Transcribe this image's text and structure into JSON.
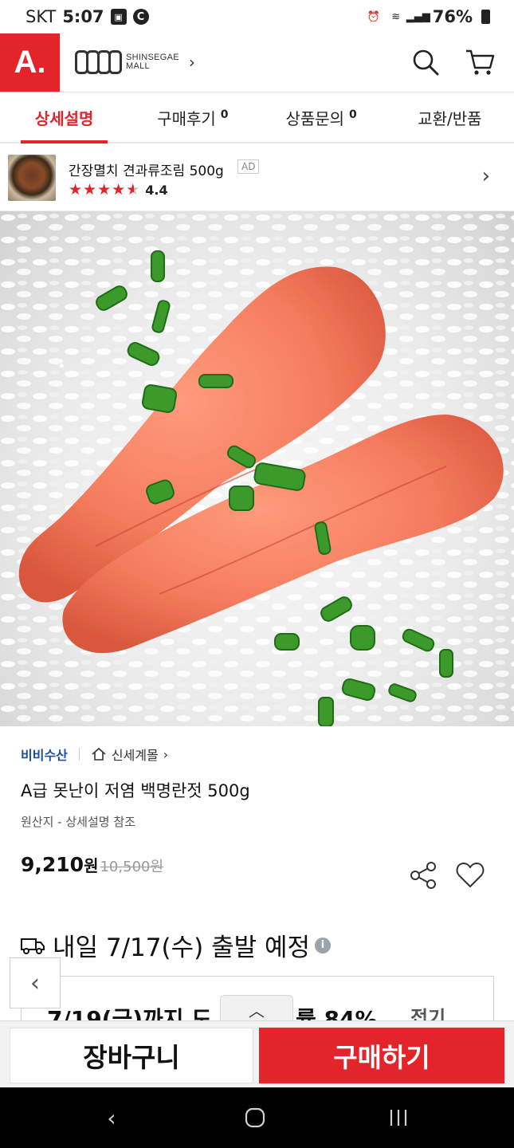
{
  "status_bar": {
    "carrier": "SKT",
    "time": "5:07",
    "battery": "76%"
  },
  "header": {
    "logo_letter": "A.",
    "brand_line1": "SHINSEGAE",
    "brand_line2": "MALL"
  },
  "tabs": [
    {
      "label": "상세설명",
      "count": ""
    },
    {
      "label": "구매후기",
      "count": "0"
    },
    {
      "label": "상품문의",
      "count": "0"
    },
    {
      "label": "교환/반품",
      "count": ""
    }
  ],
  "ad": {
    "title": "간장멸치 견과류조림 500g",
    "badge": "AD",
    "rating": "4.4",
    "rating_value": 4.4,
    "rating_max": 5
  },
  "product": {
    "seller": "비비수산",
    "mall": "신세계몰",
    "title": "A급 못난이 저염 백명란젓  500g",
    "origin": "원산지 - 상세설명 참조",
    "price": "9,210",
    "price_unit": "원",
    "original_price": "10,500원"
  },
  "delivery": {
    "text": "내일 7/17(수) 출발 예정"
  },
  "promo": {
    "text": "7/19(금)까지 도",
    "text2": "률 84%",
    "right": "접기"
  },
  "actions": {
    "cart": "장바구니",
    "buy": "구매하기"
  },
  "colors": {
    "brand_red": "#e3242b",
    "seller_blue": "#1d4f9a"
  }
}
